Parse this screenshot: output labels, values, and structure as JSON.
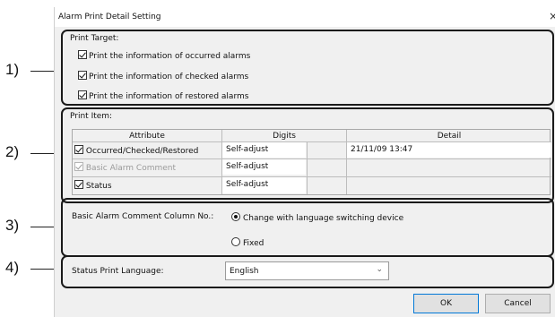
{
  "callouts": [
    "1)",
    "2)",
    "3)",
    "4)"
  ],
  "dialog": {
    "title": "Alarm Print Detail Setting",
    "close_glyph": "×"
  },
  "print_target": {
    "label": "Print Target:",
    "options": [
      {
        "label": "Print the information of occurred alarms",
        "checked": true
      },
      {
        "label": "Print the information of checked alarms",
        "checked": true
      },
      {
        "label": "Print the information of restored alarms",
        "checked": true
      }
    ]
  },
  "print_item": {
    "label": "Print Item:",
    "columns": [
      "Attribute",
      "Digits",
      "Detail"
    ],
    "rows": [
      {
        "attribute": "Occurred/Checked/Restored",
        "digits": "Self-adjust",
        "detail": "21/11/09 13:47",
        "checked": true,
        "enabled": true
      },
      {
        "attribute": "Basic Alarm Comment",
        "digits": "Self-adjust",
        "detail": "",
        "checked": true,
        "enabled": false
      },
      {
        "attribute": "Status",
        "digits": "Self-adjust",
        "detail": "",
        "checked": true,
        "enabled": true
      }
    ]
  },
  "comment_column": {
    "label": "Basic Alarm Comment Column No.:",
    "options": [
      {
        "label": "Change with language switching device",
        "selected": true
      },
      {
        "label": "Fixed",
        "selected": false
      }
    ]
  },
  "status_language": {
    "label": "Status Print Language:",
    "value": "English",
    "chevron": "⌄"
  },
  "buttons": {
    "ok": "OK",
    "cancel": "Cancel"
  },
  "colors": {
    "section_border": "#1a1a1a",
    "dialog_bg": "#f0f0f0",
    "default_button_border": "#0078d7"
  },
  "icons": [
    "check-icon",
    "radio-icon",
    "chevron-down-icon",
    "close-icon"
  ]
}
